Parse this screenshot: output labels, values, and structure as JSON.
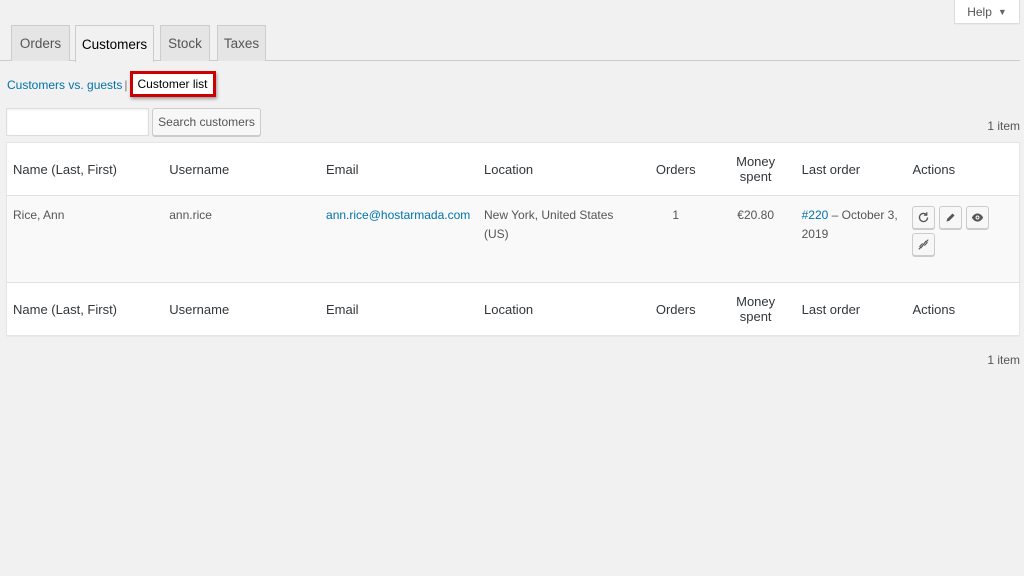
{
  "help": {
    "label": "Help",
    "caret": "▼"
  },
  "tabs": [
    {
      "label": "Orders",
      "active": false
    },
    {
      "label": "Customers",
      "active": true
    },
    {
      "label": "Stock",
      "active": false
    },
    {
      "label": "Taxes",
      "active": false
    }
  ],
  "subnav": {
    "link": "Customers vs. guests",
    "separator": "|",
    "current": "Customer list"
  },
  "search": {
    "value": "",
    "placeholder": "",
    "button_label": "Search customers"
  },
  "pagination": {
    "top": "1 item",
    "bottom": "1 item"
  },
  "table": {
    "columns": [
      "Name (Last, First)",
      "Username",
      "Email",
      "Location",
      "Orders",
      "Money spent",
      "Last order",
      "Actions"
    ],
    "rows": [
      {
        "name": "Rice, Ann",
        "username": "ann.rice",
        "email": "ann.rice@hostarmada.com",
        "location": "New York, United States (US)",
        "orders": "1",
        "money_spent": "€20.80",
        "last_order_link": "#220",
        "last_order_date": " – October 3, 2019",
        "actions": [
          "refresh-icon",
          "edit-icon",
          "view-icon",
          "link-icon"
        ]
      }
    ]
  },
  "colors": {
    "link": "#0073aa",
    "highlight_border": "#cc0000",
    "background": "#f1f1f1"
  }
}
